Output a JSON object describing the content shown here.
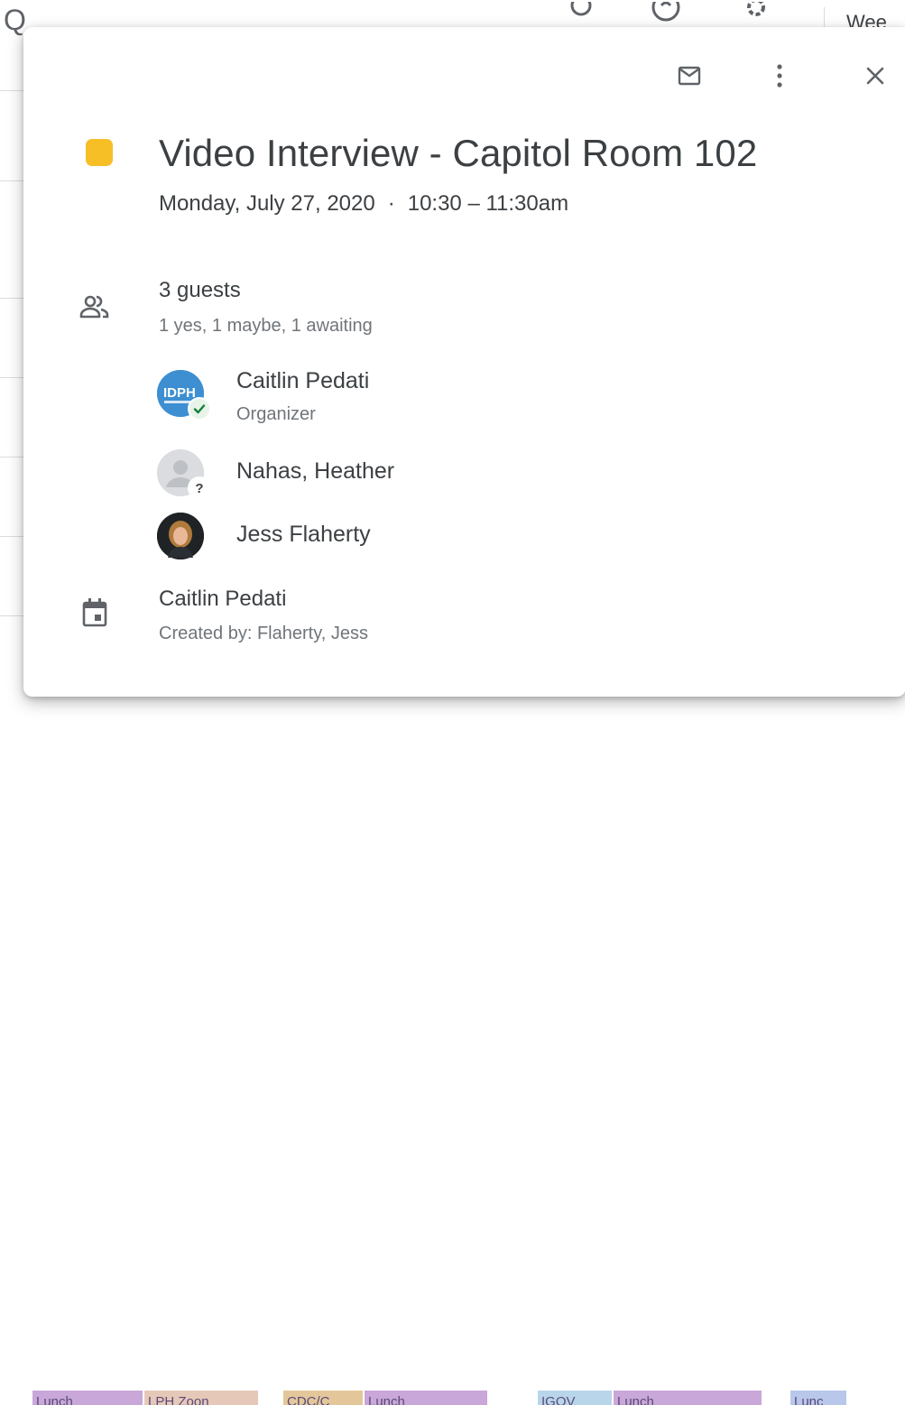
{
  "background": {
    "header_fragment_glyph": "Q",
    "view_label_fragment": "Wee",
    "bottom_chips": [
      {
        "label": "Lunch",
        "color": "#c9a7d8"
      },
      {
        "label": "LPH Zoon",
        "color": "#e6c8b8"
      },
      {
        "label": "CDC/C",
        "color": "#e3c79b"
      },
      {
        "label": "Lunch",
        "color": "#c9a7d8"
      },
      {
        "label": "IGOV",
        "color": "#b9d5ea"
      },
      {
        "label": "Lunch",
        "color": "#c9a7d8"
      },
      {
        "label": "Lunc",
        "color": "#b9c7ea"
      }
    ]
  },
  "event": {
    "color": "#f6bf26",
    "title": "Video Interview - Capitol Room 102",
    "date": "Monday, July 27, 2020",
    "separator": "·",
    "time": "10:30 – 11:30am",
    "actions": {
      "email_icon": "email-icon",
      "more_icon": "more-vert-icon",
      "close_icon": "close-icon"
    },
    "guests": {
      "summary": "3 guests",
      "status": "1 yes, 1 maybe, 1 awaiting",
      "list": [
        {
          "name": "Caitlin Pedati",
          "role": "Organizer",
          "avatar": "idph-logo",
          "avatar_text": "IDPH",
          "response": "yes"
        },
        {
          "name": "Nahas, Heather",
          "role": "",
          "avatar": "default-person",
          "response": "maybe",
          "badge_text": "?"
        },
        {
          "name": "Jess Flaherty",
          "role": "",
          "avatar": "photo",
          "response": "awaiting"
        }
      ]
    },
    "calendar": {
      "name": "Caitlin Pedati",
      "created_by": "Created by: Flaherty, Jess"
    }
  }
}
